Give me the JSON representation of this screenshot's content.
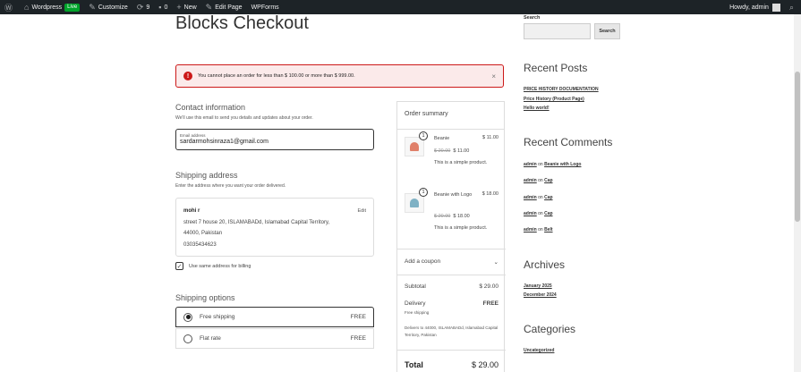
{
  "adminbar": {
    "site": "Wordpress",
    "live": "Live",
    "customize": "Customize",
    "updates": "9",
    "comments": "0",
    "new": "New",
    "edit_page": "Edit Page",
    "wpforms": "WPForms",
    "howdy": "Howdy, admin"
  },
  "page": {
    "title": "Blocks Checkout"
  },
  "notice": {
    "text": "You cannot place an order for less than $ 100.00 or more than $ 999.00.",
    "close": "×"
  },
  "contact": {
    "title": "Contact information",
    "desc": "We'll use this email to send you details and updates about your order.",
    "email_label": "Email address",
    "email_value": "sardarmohsinraza1@gmail.com"
  },
  "shipping_address": {
    "title": "Shipping address",
    "desc": "Enter the address where you want your order delivered.",
    "name": "mohi r",
    "line1": "street 7 house 20, ISLAMABADd, Islamabad Capital Territory,",
    "line2": "44000, Pakistan",
    "phone": "03035434623",
    "edit": "Edit",
    "billing_same": "Use same address for billing"
  },
  "shipping_options": {
    "title": "Shipping options",
    "options": [
      {
        "label": "Free shipping",
        "price": "FREE",
        "selected": true
      },
      {
        "label": "Flat rate",
        "price": "FREE",
        "selected": false
      }
    ]
  },
  "summary": {
    "title": "Order summary",
    "items": [
      {
        "qty": "1",
        "name": "Beanie",
        "price": "$ 11.00",
        "old": "$ 20.00",
        "new": "$ 11.00",
        "desc": "This is a simple product.",
        "color": "#e0806a"
      },
      {
        "qty": "1",
        "name": "Beanie with Logo",
        "price": "$ 18.00",
        "old": "$ 20.00",
        "new": "$ 18.00",
        "desc": "This is a simple product.",
        "color": "#7fb1c4"
      }
    ],
    "coupon": "Add a coupon",
    "subtotal_label": "Subtotal",
    "subtotal": "$ 29.00",
    "delivery_label": "Delivery",
    "delivery_value": "FREE",
    "delivery_method": "Free shipping",
    "delivers_to": "Delivers to 44000, ISLAMABADd, Islamabad Capital Territory, Pakistan",
    "total_label": "Total",
    "total": "$ 29.00"
  },
  "sidebar": {
    "search_label": "Search",
    "search_button": "Search",
    "recent_posts_title": "Recent Posts",
    "recent_posts": [
      "PRICE HISTORY DOCUMENTATION",
      "Price History (Product Page)",
      "Hello world!"
    ],
    "recent_comments_title": "Recent Comments",
    "comments": [
      {
        "author": "admin",
        "on": "on",
        "post": "Beanie with Logo"
      },
      {
        "author": "admin",
        "on": "on",
        "post": "Cap"
      },
      {
        "author": "admin",
        "on": "on",
        "post": "Cap"
      },
      {
        "author": "admin",
        "on": "on",
        "post": "Cap"
      },
      {
        "author": "admin",
        "on": "on",
        "post": "Belt"
      }
    ],
    "archives_title": "Archives",
    "archives": [
      "January 2025",
      "December 2024"
    ],
    "categories_title": "Categories",
    "categories": [
      "Uncategorized"
    ]
  }
}
